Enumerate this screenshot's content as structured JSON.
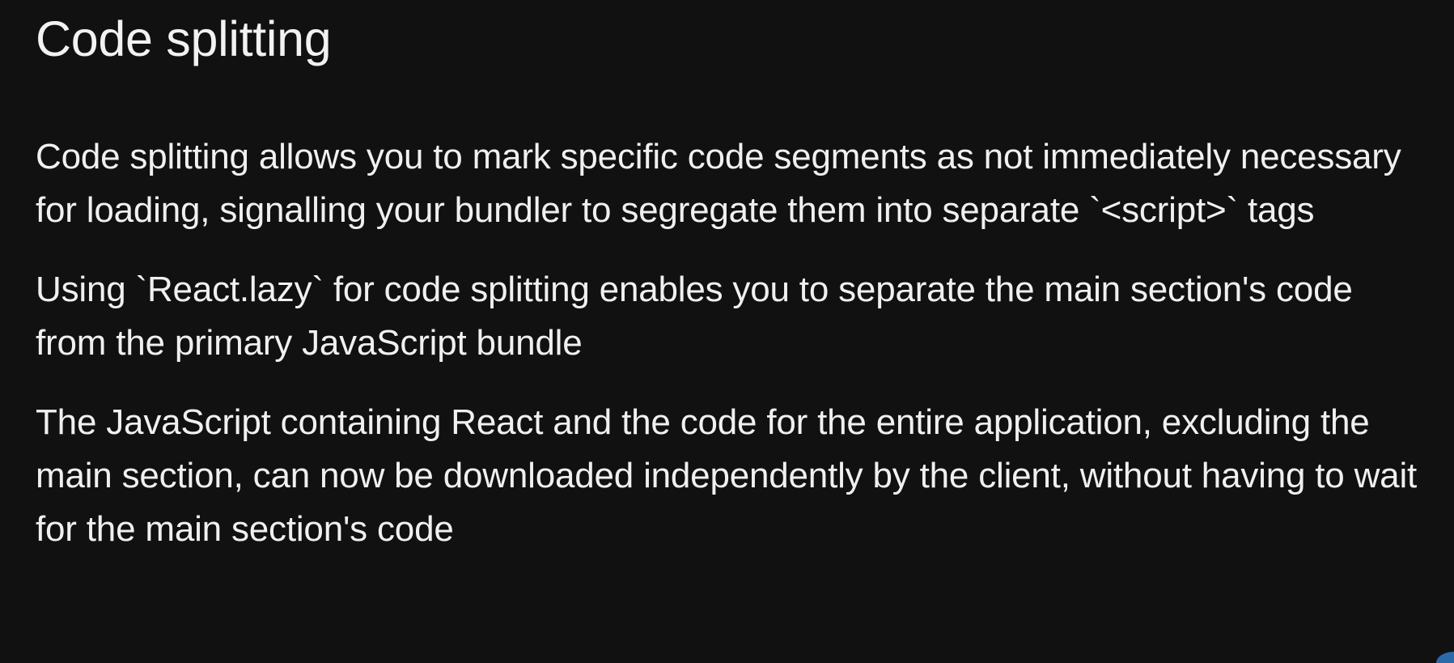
{
  "slide": {
    "title": "Code splitting",
    "paragraphs": [
      "Code splitting allows you to mark specific code segments as not immediately necessary for loading, signalling your bundler to segregate them into separate `<script>` tags",
      "Using `React.lazy` for code splitting enables you to separate the main section's code from the primary JavaScript bundle",
      "The JavaScript containing React and the code for the entire application, excluding the main section, can now be downloaded independently by the client, without having to wait for the main section's code"
    ]
  },
  "colors": {
    "background": "#111111",
    "text": "#f2f2f2",
    "accent": "#2b6aa8"
  }
}
